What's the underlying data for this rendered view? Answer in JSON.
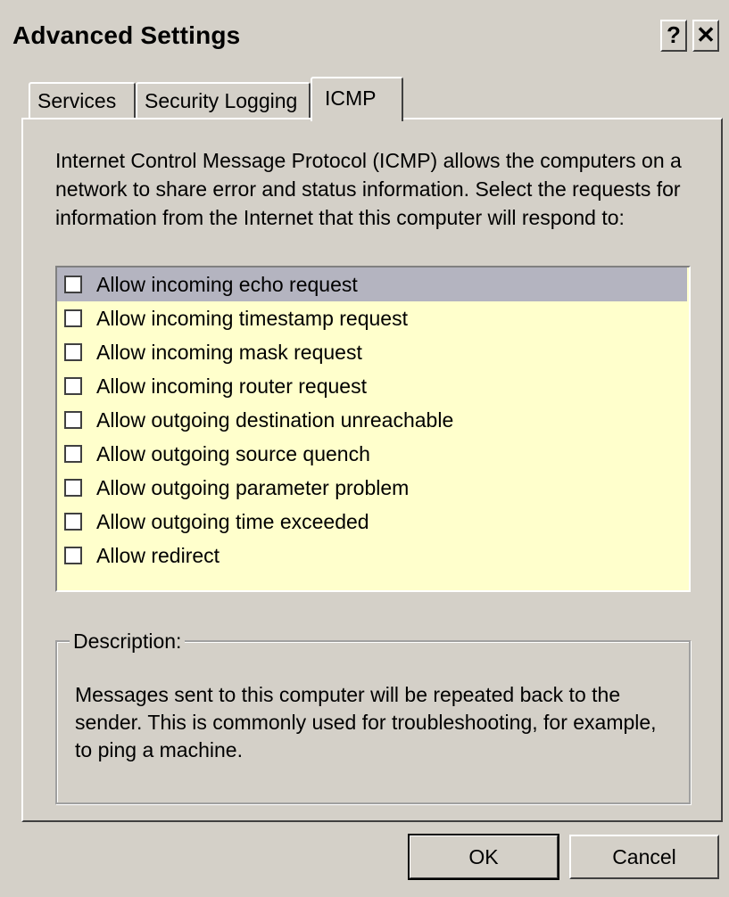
{
  "window": {
    "title": "Advanced Settings",
    "help_label": "?",
    "close_label": "✕"
  },
  "tabs": [
    {
      "label": "Services",
      "active": false
    },
    {
      "label": "Security Logging",
      "active": false
    },
    {
      "label": "ICMP",
      "active": true
    }
  ],
  "intro_text": "Internet Control Message Protocol (ICMP) allows the computers on a network to share error and status information. Select the requests for information from the Internet that this computer will respond to:",
  "options": [
    {
      "label": "Allow incoming echo request",
      "checked": false,
      "selected": true
    },
    {
      "label": "Allow incoming timestamp request",
      "checked": false,
      "selected": false
    },
    {
      "label": "Allow incoming mask request",
      "checked": false,
      "selected": false
    },
    {
      "label": "Allow incoming router request",
      "checked": false,
      "selected": false
    },
    {
      "label": "Allow outgoing destination unreachable",
      "checked": false,
      "selected": false
    },
    {
      "label": "Allow outgoing source quench",
      "checked": false,
      "selected": false
    },
    {
      "label": "Allow outgoing parameter problem",
      "checked": false,
      "selected": false
    },
    {
      "label": "Allow outgoing time exceeded",
      "checked": false,
      "selected": false
    },
    {
      "label": "Allow redirect",
      "checked": false,
      "selected": false
    }
  ],
  "description": {
    "legend": "Description:",
    "text": "Messages sent to this computer will be repeated back to the sender. This is commonly used for troubleshooting, for example, to ping a machine."
  },
  "buttons": {
    "ok_label": "OK",
    "cancel_label": "Cancel"
  },
  "colors": {
    "dialog_bg": "#d4d0c8",
    "list_bg": "#ffffcc",
    "selected_row": "#b4b4c0"
  }
}
